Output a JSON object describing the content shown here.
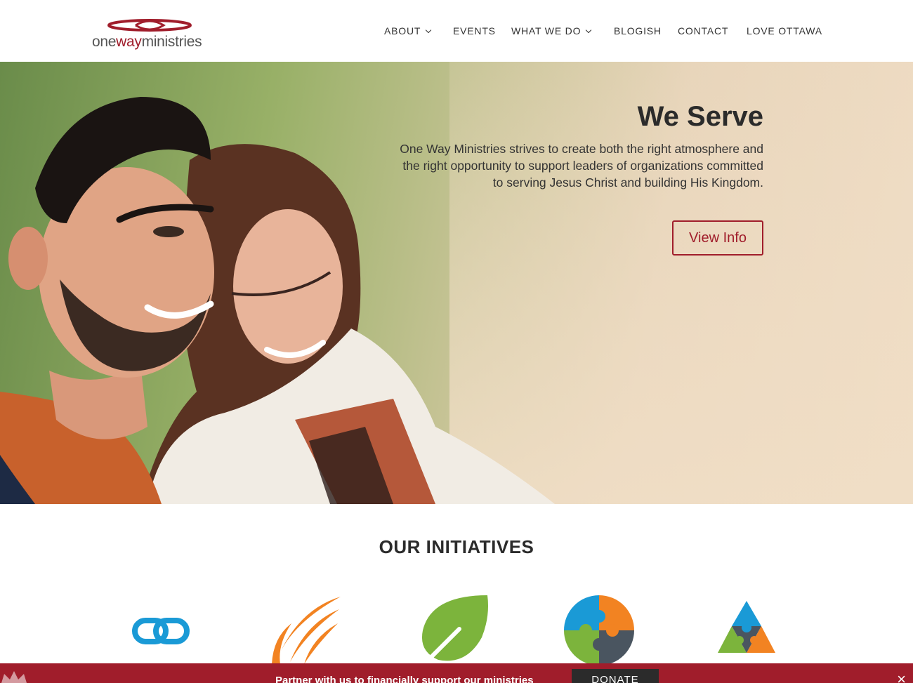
{
  "header": {
    "logo": {
      "part1": "one",
      "part2": "way",
      "part3": "ministries"
    },
    "nav": [
      {
        "label": "ABOUT",
        "dropdown": true
      },
      {
        "label": "EVENTS",
        "dropdown": false
      },
      {
        "label": "WHAT WE DO",
        "dropdown": true
      },
      {
        "label": "BLOGISH",
        "dropdown": false
      },
      {
        "label": "CONTACT",
        "dropdown": false
      },
      {
        "label": "LOVE OTTAWA",
        "dropdown": false
      }
    ]
  },
  "hero": {
    "title": "We Serve",
    "text": "One Way Ministries strives to create both the right atmosphere and the right opportunity to support leaders of organizations committed to serving Jesus Christ and building His Kingdom.",
    "button": "View Info"
  },
  "initiatives": {
    "title": "OUR INITIATIVES",
    "icons": [
      "chain-link-icon",
      "wing-icon",
      "leaf-icon",
      "puzzle-circle-icon",
      "puzzle-triangle-icon"
    ]
  },
  "donate_bar": {
    "text": "Partner with us to financially support our ministries",
    "button": "DONATE",
    "close": "×"
  },
  "colors": {
    "brand": "#a01d2b",
    "text": "#333333",
    "dark_button": "#2b2b2b"
  }
}
